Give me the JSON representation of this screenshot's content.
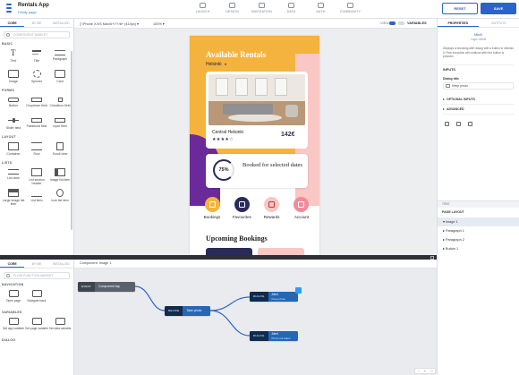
{
  "app": {
    "name": "Rentals App",
    "subtitle": "Firstly page"
  },
  "topnav": [
    {
      "label": "LAUNCH",
      "icon": "rocket-icon"
    },
    {
      "label": "DESIGN",
      "icon": "design-icon"
    },
    {
      "label": "NAVIGATION",
      "icon": "navigation-icon"
    },
    {
      "label": "DATA",
      "icon": "database-icon"
    },
    {
      "label": "AUTH",
      "icon": "lock-icon"
    },
    {
      "label": "COMMUNITY",
      "icon": "community-icon"
    }
  ],
  "toolbar": {
    "reset_label": "RESET",
    "save_label": "SAVE"
  },
  "left": {
    "tabs": [
      "CORE",
      "BY ME",
      "INSTALLED"
    ],
    "search_placeholder": "COMPONENT MARKET",
    "sections": [
      {
        "title": "BASIC",
        "items": [
          {
            "label": "Text",
            "icon": "text"
          },
          {
            "label": "Title",
            "icon": "title"
          },
          {
            "label": "Paragraph",
            "icon": "para"
          },
          {
            "label": "Image",
            "icon": "image"
          },
          {
            "label": "Spinner",
            "icon": "spinner"
          },
          {
            "label": "Card",
            "icon": "card"
          }
        ]
      },
      {
        "title": "FORMS",
        "items": [
          {
            "label": "Button",
            "icon": "button"
          },
          {
            "label": "Dropdown field",
            "icon": "dropdown"
          },
          {
            "label": "Checkbox field",
            "icon": "checkbox"
          },
          {
            "label": "Slider field",
            "icon": "slider"
          },
          {
            "label": "Password field",
            "icon": "password"
          },
          {
            "label": "Input field",
            "icon": "input"
          }
        ]
      },
      {
        "title": "LAYOUT",
        "items": [
          {
            "label": "Container",
            "icon": "container"
          },
          {
            "label": "Row",
            "icon": "row"
          },
          {
            "label": "Scroll view",
            "icon": "scroll"
          }
        ]
      },
      {
        "title": "LISTS",
        "items": [
          {
            "label": "List view",
            "icon": "list"
          },
          {
            "label": "List section header",
            "icon": "listsec"
          },
          {
            "label": "Image list item",
            "icon": "imglist"
          },
          {
            "label": "Large image list item",
            "icon": "largeimg"
          },
          {
            "label": "List item",
            "icon": "listitem"
          },
          {
            "label": "Icon list item",
            "icon": "iconitem"
          }
        ]
      }
    ]
  },
  "canvas": {
    "device": "iPhone X/XS Max/6+/7+/8+ (414px)",
    "zoom": "100%",
    "view_label": "VIEW",
    "variables_label": "VARIABLES"
  },
  "phone": {
    "hero_title": "Available Rentals",
    "city": "Helsinki",
    "card_name": "Central Helsinki",
    "stars": "★★★★☆",
    "rating": 4,
    "price": "142€",
    "booked_pct": "75%",
    "booked_pct_value": 0.75,
    "booked_text": "Booked for selected dates",
    "categories": [
      {
        "label": "Bookings",
        "color": "#f4b33f",
        "fg": "#fff",
        "icon": "bookings-icon"
      },
      {
        "label": "Favourites",
        "color": "#2a2a5a",
        "fg": "#fff",
        "icon": "favourites-icon"
      },
      {
        "label": "Rewards",
        "color": "#f9c7c4",
        "fg": "#b83a3a",
        "icon": "rewards-icon"
      },
      {
        "label": "Account",
        "color": "#f28a9a",
        "fg": "#fff",
        "icon": "account-icon"
      }
    ],
    "upcoming_title": "Upcoming Bookings"
  },
  "right": {
    "tabs": [
      "PROPERTIES",
      "OUTPUTS"
    ],
    "selected_name": "Mbrill",
    "selected_sub": "Logic: Mbrill",
    "description": "Displays a browsing alert dialog with a button to dismiss & Flow execution will continue after the button is pressed.",
    "inputs_head": "INPUTS",
    "dialog_title_label": "Dialog title",
    "dialog_title_value": "Keep photo",
    "optional_inputs": "OPTIONAL INPUTS",
    "advanced": "ADVANCED",
    "tree_head": "TREE",
    "tree_label": "PAGE LAYOUT",
    "tree_items": [
      "Image 1",
      "Paragraph 1",
      "Paragraph 2",
      "Button 1"
    ]
  },
  "logic": {
    "tabs": [
      "CORE",
      "BY ME",
      "INSTALLED"
    ],
    "search_placeholder": "FLOW FUNCTION MARKET",
    "sections": [
      {
        "title": "NAVIGATION",
        "items": [
          {
            "label": "Open page"
          },
          {
            "label": "Navigate back"
          }
        ]
      },
      {
        "title": "VARIABLES",
        "items": [
          {
            "label": "Set app variable"
          },
          {
            "label": "Set page variable"
          },
          {
            "label": "Set data variable"
          }
        ]
      },
      {
        "title": "DIALOG",
        "items": []
      }
    ],
    "title": "Component: Image 1",
    "nodes": {
      "event": {
        "tag": "EVENT",
        "label": "Component tap"
      },
      "device": {
        "tag": "DEVICE",
        "label": "Take photo"
      },
      "alert1": {
        "tag": "DIALOG",
        "label": "Alert",
        "sub": "Keep photo"
      },
      "alert2": {
        "tag": "DIALOG",
        "label": "Alert",
        "sub": "Photo not taken"
      }
    },
    "zoom_minus": "−",
    "zoom_plus": "+",
    "zoom_fit": "□"
  },
  "colors": {
    "accent": "#2d63c8",
    "node_blue": "#2467b4",
    "node_dark": "#0f2b4d",
    "hero_yellow": "#f4b33f",
    "hero_pink": "#f9c7c4",
    "hero_purple": "#6a2a9a"
  }
}
